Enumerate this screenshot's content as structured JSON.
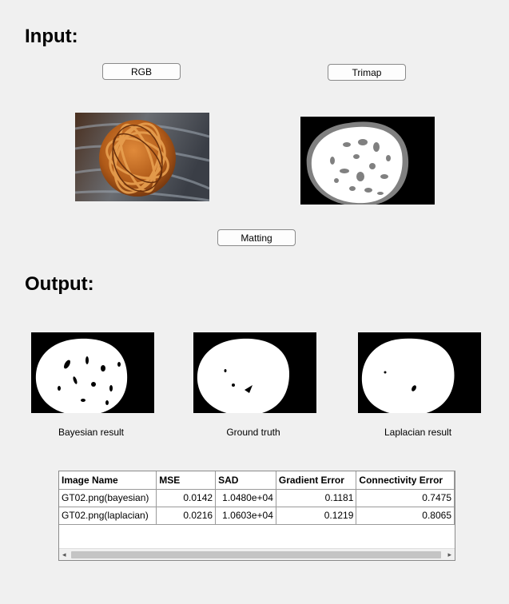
{
  "input_section": {
    "heading": "Input:"
  },
  "buttons": {
    "rgb": "RGB",
    "trimap": "Trimap",
    "matting": "Matting"
  },
  "output_section": {
    "heading": "Output:"
  },
  "captions": {
    "bayesian": "Bayesian result",
    "ground_truth": "Ground truth",
    "laplacian": "Laplacian result"
  },
  "table": {
    "columns": [
      "Image Name",
      "MSE",
      "SAD",
      "Gradient Error",
      "Connectivity Error"
    ],
    "rows": [
      [
        "GT02.png(bayesian)",
        "0.0142",
        "1.0480e+04",
        "0.1181",
        "0.7475"
      ],
      [
        "GT02.png(laplacian)",
        "0.0216",
        "1.0603e+04",
        "0.1219",
        "0.8065"
      ]
    ]
  },
  "scrollbar": {
    "left_arrow": "◂",
    "right_arrow": "▸"
  },
  "colors": {
    "background": "#f0f0f0",
    "rattan": "#c06a20",
    "trimap_unknown": "#808080"
  }
}
